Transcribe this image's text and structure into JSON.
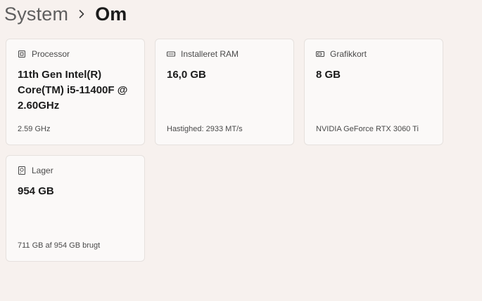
{
  "breadcrumb": {
    "parent": "System",
    "current": "Om"
  },
  "cards": [
    {
      "icon": "processor-icon",
      "label": "Processor",
      "value": "11th Gen Intel(R) Core(TM) i5-11400F @ 2.60GHz",
      "sub": "2.59 GHz"
    },
    {
      "icon": "ram-icon",
      "label": "Installeret RAM",
      "value": "16,0 GB",
      "sub": "Hastighed: 2933 MT/s"
    },
    {
      "icon": "graphics-card-icon",
      "label": "Grafikkort",
      "value": "8 GB",
      "sub": "NVIDIA GeForce RTX 3060 Ti"
    },
    {
      "icon": "storage-icon",
      "label": "Lager",
      "value": "954 GB",
      "sub": "711 GB af 954 GB brugt"
    }
  ]
}
